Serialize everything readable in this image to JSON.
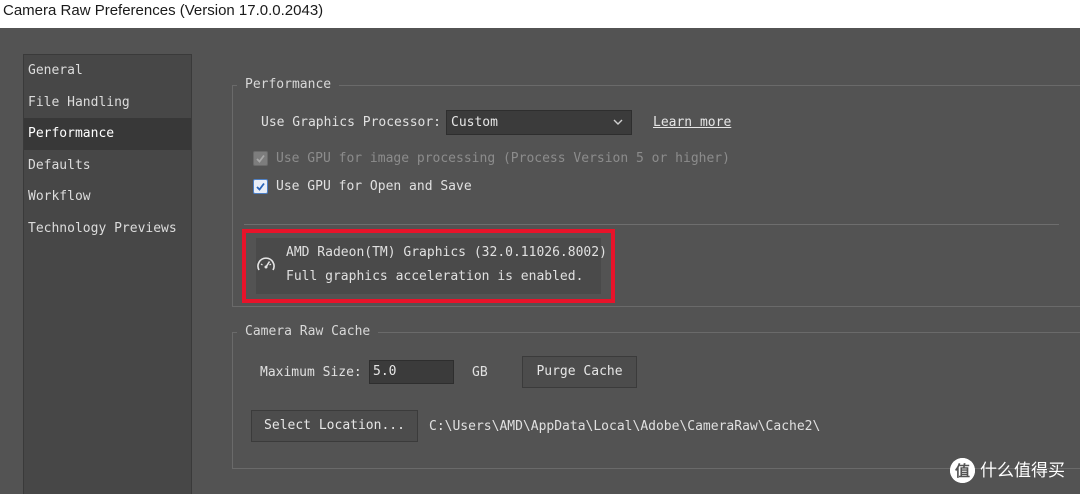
{
  "window": {
    "title": "Camera Raw Preferences  (Version 17.0.0.2043)"
  },
  "sidebar": {
    "items": [
      {
        "label": "General"
      },
      {
        "label": "File Handling"
      },
      {
        "label": "Performance",
        "selected": true
      },
      {
        "label": "Defaults"
      },
      {
        "label": "Workflow"
      },
      {
        "label": "Technology Previews"
      }
    ]
  },
  "performance": {
    "legend": "Performance",
    "gpu_label": "Use Graphics Processor:",
    "gpu_value": "Custom",
    "learn_more": "Learn more",
    "checkboxes": [
      {
        "label": "Use GPU for image processing (Process Version 5 or higher)",
        "checked": true,
        "disabled": true
      },
      {
        "label": "Use GPU for Open and Save",
        "checked": true,
        "disabled": false
      }
    ],
    "gpu_info": {
      "name": "AMD Radeon(TM) Graphics (32.0.11026.8002)",
      "status": "Full graphics acceleration is enabled."
    },
    "highlight_color": "#e8132a"
  },
  "cache": {
    "legend": "Camera Raw Cache",
    "max_size_label": "Maximum Size:",
    "max_size_value": "5.0",
    "unit": "GB",
    "purge_label": "Purge Cache",
    "select_location_label": "Select Location...",
    "path": "C:\\Users\\AMD\\AppData\\Local\\Adobe\\CameraRaw\\Cache2\\"
  },
  "watermark": {
    "text": "什么值得买"
  }
}
